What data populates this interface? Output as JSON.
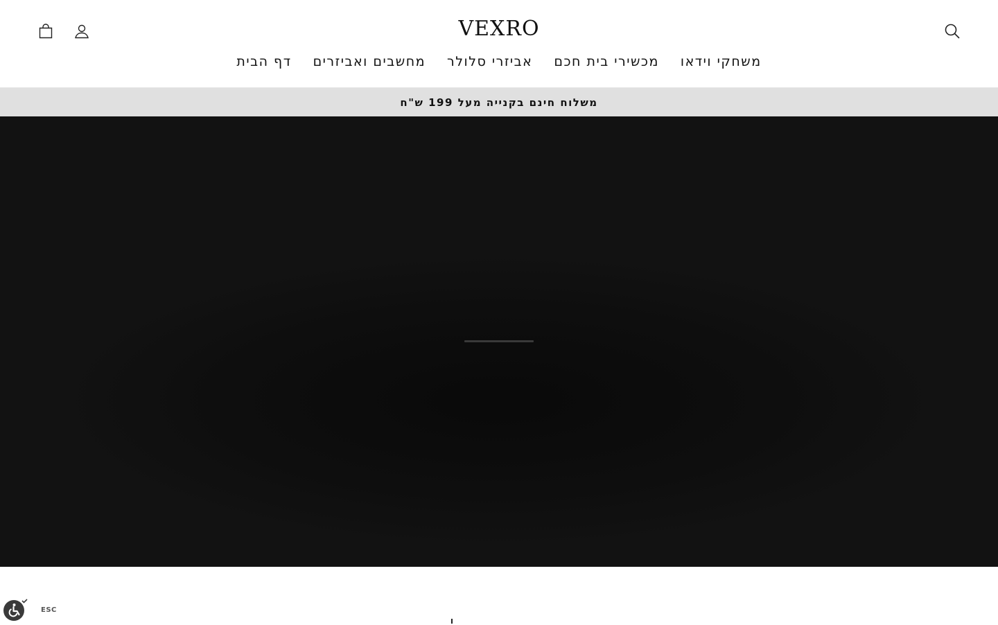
{
  "header": {
    "logo": "VEXRO",
    "icons": {
      "cart": "shopping-bag-icon",
      "account": "user-icon",
      "search": "search-icon"
    }
  },
  "nav": {
    "items": [
      {
        "label": "דף הבית"
      },
      {
        "label": "מחשבים ואביזרים"
      },
      {
        "label": "אביזרי סלולר"
      },
      {
        "label": "מכשירי בית חכם"
      },
      {
        "label": "משחקי וידאו"
      }
    ]
  },
  "announcement": {
    "text": "משלוח חינם בקנייה מעל 199 ש\"ח"
  },
  "hero": {
    "background_color": "#121212",
    "loading_indicator": "loading-bar"
  },
  "accessibility": {
    "icon": "accessibility-icon",
    "esc_label": "ESC"
  },
  "colors": {
    "text": "#111111",
    "announcement_bg": "#e0e0e0",
    "hero_bg": "#121212"
  }
}
